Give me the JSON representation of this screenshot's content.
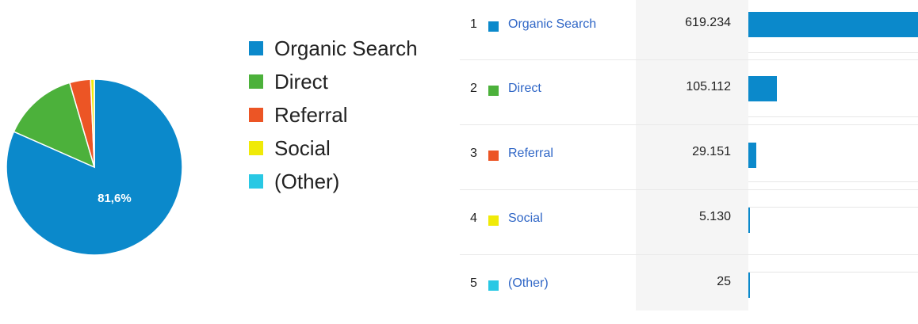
{
  "chart_data": [
    {
      "type": "pie",
      "categories": [
        "Organic Search",
        "Direct",
        "Referral",
        "Social",
        "(Other)"
      ],
      "values": [
        619234,
        105112,
        29151,
        5130,
        25
      ],
      "colors": [
        "#0b89cb",
        "#4cb13b",
        "#ec5525",
        "#f0ea08",
        "#29c8e4"
      ],
      "slice_labels": [
        "81,6%",
        "",
        "",
        "",
        ""
      ]
    },
    {
      "type": "bar",
      "orientation": "horizontal",
      "categories": [
        "Organic Search",
        "Direct",
        "Referral",
        "Social",
        "(Other)"
      ],
      "values": [
        619234,
        105112,
        29151,
        5130,
        25
      ],
      "value_labels": [
        "619.234",
        "105.112",
        "29.151",
        "5.130",
        "25"
      ],
      "bar_color": "#0b89cb"
    }
  ],
  "legend": [
    {
      "label": "Organic Search",
      "color": "#0b89cb"
    },
    {
      "label": "Direct",
      "color": "#4cb13b"
    },
    {
      "label": "Referral",
      "color": "#ec5525"
    },
    {
      "label": "Social",
      "color": "#f0ea08"
    },
    {
      "label": "(Other)",
      "color": "#29c8e4"
    }
  ],
  "table": {
    "rows": [
      {
        "index": "1",
        "label": "Organic Search",
        "value": "619.234",
        "color": "#0b89cb"
      },
      {
        "index": "2",
        "label": "Direct",
        "value": "105.112",
        "color": "#4cb13b"
      },
      {
        "index": "3",
        "label": "Referral",
        "value": "29.151",
        "color": "#ec5525"
      },
      {
        "index": "4",
        "label": "Social",
        "value": "5.130",
        "color": "#f0ea08"
      },
      {
        "index": "5",
        "label": "(Other)",
        "value": "25",
        "color": "#29c8e4"
      }
    ]
  }
}
